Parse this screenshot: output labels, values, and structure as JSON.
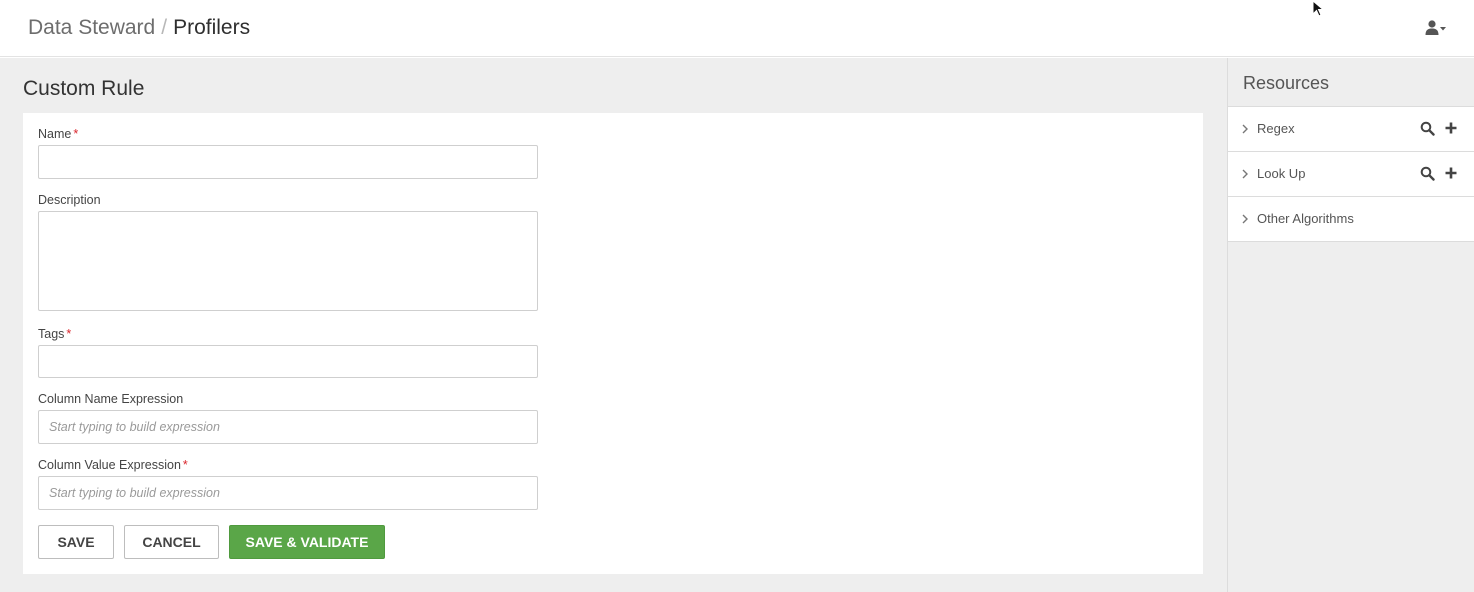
{
  "breadcrumb": {
    "root": "Data Steward",
    "separator": "/",
    "current": "Profilers"
  },
  "page": {
    "title": "Custom Rule"
  },
  "form": {
    "name": {
      "label": "Name",
      "required_mark": "*",
      "value": "",
      "placeholder": ""
    },
    "description": {
      "label": "Description",
      "value": "",
      "placeholder": ""
    },
    "tags": {
      "label": "Tags",
      "required_mark": "*",
      "value": "",
      "placeholder": ""
    },
    "column_name_expression": {
      "label": "Column Name Expression",
      "value": "",
      "placeholder": "Start typing to build expression"
    },
    "column_value_expression": {
      "label": "Column Value Expression",
      "required_mark": "*",
      "value": "",
      "placeholder": "Start typing to build expression"
    }
  },
  "buttons": {
    "save": "SAVE",
    "cancel": "CANCEL",
    "save_validate": "SAVE & VALIDATE"
  },
  "resources": {
    "title": "Resources",
    "items": [
      {
        "label": "Regex",
        "icons": [
          "chevron-right-icon",
          "search-icon",
          "plus-icon"
        ]
      },
      {
        "label": "Look Up",
        "icons": [
          "chevron-right-icon",
          "search-icon",
          "plus-icon"
        ]
      },
      {
        "label": "Other Algorithms",
        "icons": [
          "chevron-right-icon"
        ]
      }
    ]
  },
  "icons": {
    "user_menu": "user-icon",
    "user_menu_caret": "caret-down-icon"
  },
  "colors": {
    "primary_button": "#5aa648",
    "required": "#d9242b",
    "background": "#eeeeee"
  }
}
